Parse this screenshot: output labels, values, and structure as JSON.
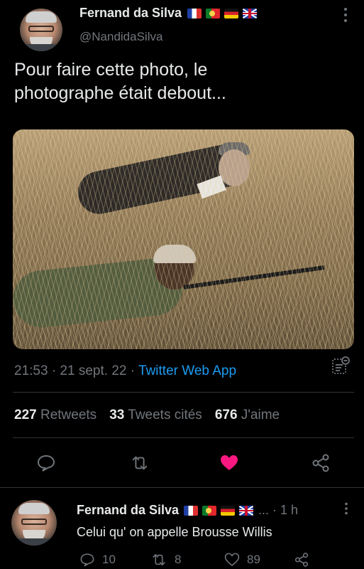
{
  "tweet": {
    "author_name": "Fernand da Silva",
    "handle": "@NandidaSilva",
    "text_line1": "Pour faire cette photo, le",
    "text_line2": "photographe était debout...",
    "time": "21:53",
    "date": "21 sept. 22",
    "app": "Twitter Web App",
    "sep": "·",
    "retweets_count": "227",
    "retweets_label": "Retweets",
    "quotes_count": "33",
    "quotes_label": "Tweets cités",
    "likes_count": "676",
    "likes_label": "J'aime",
    "liked_color": "#f91880"
  },
  "reply": {
    "author_name": "Fernand da Silva",
    "dots": "... · 1 h",
    "text": "Celui qu' on appelle Brousse Willis",
    "replies": "10",
    "retweets": "8",
    "likes": "89"
  },
  "colors": {
    "background": "#000000",
    "text": "#e7e9ea",
    "muted": "#71767b",
    "accent": "#1d9bf0"
  },
  "icons": [
    "more-vertical-icon",
    "analytics-icon",
    "reply-icon",
    "retweet-icon",
    "heart-icon",
    "share-icon"
  ]
}
